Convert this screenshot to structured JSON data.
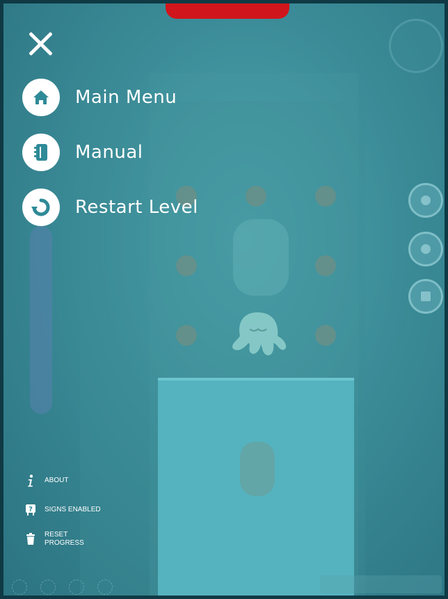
{
  "menu": {
    "items": [
      {
        "label": "Main Menu",
        "icon": "home-icon"
      },
      {
        "label": "Manual",
        "icon": "notebook-icon"
      },
      {
        "label": "Restart Level",
        "icon": "restart-icon"
      }
    ]
  },
  "footer": {
    "about_label": "ABOUT",
    "signs_label": "SIGNS ENABLED",
    "reset_label_line1": "RESET",
    "reset_label_line2": "PROGRESS"
  },
  "colors": {
    "accent": "#d0161c",
    "overlay": "#3b8c98",
    "icon_fill": "#2f8a97"
  }
}
